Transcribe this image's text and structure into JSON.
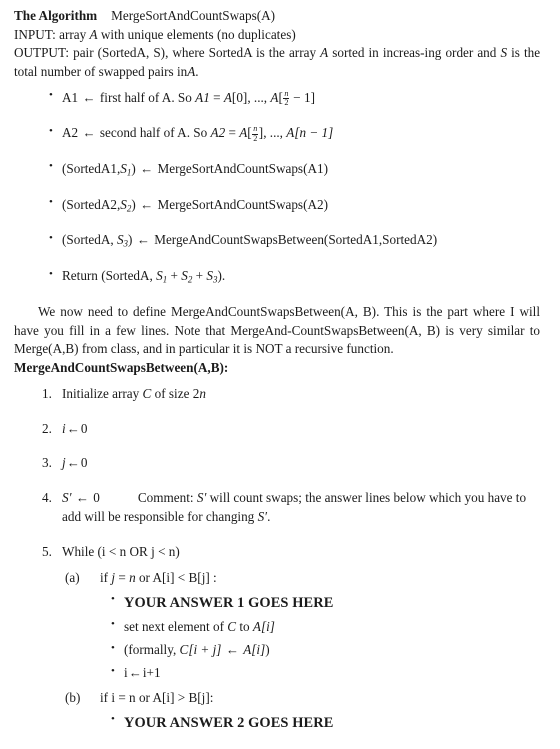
{
  "document": {
    "header": {
      "title": "The Algorithm",
      "signature": "MergeSortAndCountSwaps(A)",
      "input_label": "INPUT:",
      "input_text_1": "array",
      "input_var": "A",
      "input_text_2": "with unique elements (no duplicates)",
      "output_label": "OUTPUT:",
      "output_text_1": "pair (SortedA, S), where SortedA is the array",
      "output_var_1": "A",
      "output_text_2": "sorted in increas-ing order and",
      "output_var_2": "S",
      "output_text_3": "is the total number of swapped pairs in",
      "output_var_3": "A",
      "output_text_4": "."
    },
    "steps": {
      "item1": {
        "name": "A1",
        "arrow": "←",
        "text": "first half of A. So",
        "var": "A1",
        "eq": "=",
        "arr_var": "A",
        "bracket_open": "[",
        "index0": "0",
        "bracket_close": "]",
        "ellipsis": ", ..., ",
        "arr_var2": "A",
        "frac_num": "n",
        "frac_den": "2",
        "minus_one": "− 1]"
      },
      "item2": {
        "name": "A2",
        "arrow": "←",
        "text": "second half of A. So",
        "var": "A2",
        "eq": "=",
        "arr_var": "A",
        "frac_num": "n",
        "frac_den": "2",
        "close1": "]",
        "ellipsis": ", ..., ",
        "arr_var2": "A",
        "tail": "[n − 1]"
      },
      "item3": {
        "lhs_pre": "(SortedA1,",
        "lhs_sub": "1",
        "lhs_post": ")",
        "arrow": "←",
        "rhs": "MergeSortAndCountSwaps(A1)"
      },
      "item4": {
        "lhs_pre": "(SortedA2,",
        "lhs_sub": "2",
        "lhs_post": ")",
        "arrow": "←",
        "rhs": "MergeSortAndCountSwaps(A2)"
      },
      "item5": {
        "lhs_pre": "(SortedA,",
        "lhs_sub": "3",
        "lhs_post": ")",
        "arrow": "←",
        "rhs": "MergeAndCountSwapsBetween(SortedA1,SortedA2)"
      },
      "item6": {
        "text_pre": "Return (SortedA,",
        "s1_sub": "1",
        "plus1": "+",
        "s2_sub": "2",
        "plus2": "+",
        "s3_sub": "3",
        "text_post": ")."
      }
    },
    "paragraph": {
      "line1": "We now need to define MergeAndCountSwapsBetween(A, B). This is the part where I will have you fill in a few lines. Note that MergeAnd-CountSwapsBetween(A, B) is very similar to Merge(A,B) from class, and in particular it is NOT a recursive function."
    },
    "procedure": {
      "heading": "MergeAndCountSwapsBetween(A,B):",
      "step1": {
        "text_pre": "Initialize array",
        "var": "C",
        "text_mid": "of size",
        "size_num": "2",
        "size_var": "n"
      },
      "step2": {
        "var": "i",
        "arrow": "←",
        "value": "0"
      },
      "step3": {
        "var": "j",
        "arrow": "←",
        "value": "0"
      },
      "step4": {
        "var": "S′",
        "arrow": "←",
        "value": "0",
        "comment_label": "Comment:",
        "comment_var": "S′",
        "comment_text_1": "will count swaps; the answer lines below which you have to add will be responsible for changing",
        "comment_var_2": "S′",
        "comment_text_2": "."
      },
      "step5": {
        "text": "While (i < n OR j < n)",
        "sub_a": {
          "pre": "if",
          "var_j": "j",
          "eq": "=",
          "var_n": "n",
          "mid": "or A[i] < B[j] :",
          "bullets": {
            "answer1": "YOUR ANSWER 1 GOES HERE",
            "set_next_pre": "set next element of",
            "set_next_var": "C",
            "set_next_mid": "to",
            "set_next_arr": "A",
            "set_next_idx": "[i]",
            "formally_pre": "(formally,",
            "formally_c": "C",
            "formally_idx": "[i + j]",
            "formally_arrow": "←",
            "formally_a": "A",
            "formally_idx2": "[i]",
            "formally_post": ")",
            "incr_var": "i",
            "incr_arrow": "←",
            "incr_val": "i+1"
          }
        },
        "sub_b": {
          "text": "if i = n or A[i] > B[j]:",
          "bullets": {
            "answer2": "YOUR ANSWER 2 GOES HERE"
          }
        }
      }
    }
  }
}
